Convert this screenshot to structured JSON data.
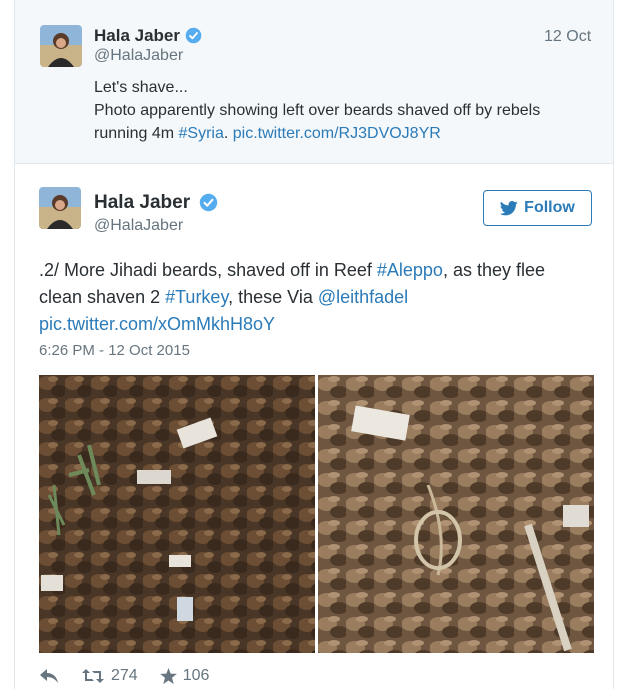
{
  "parent_tweet": {
    "name": "Hala Jaber",
    "handle": "@HalaJaber",
    "date": "12 Oct",
    "line1": "Let's shave...",
    "line2": "Photo apparently showing left over beards shaved off by rebels",
    "line3_text": "running 4m ",
    "line3_hashtag": "#Syria",
    "line3_sep": ". ",
    "line3_link": "pic.twitter.com/RJ3DVOJ8YR"
  },
  "main_tweet": {
    "name": "Hala Jaber",
    "handle": "@HalaJaber",
    "follow_label": "Follow",
    "text_part1": ".2/ More Jihadi beards, shaved off in Reef ",
    "hashtag_aleppo": "#Aleppo",
    "text_part2": ", as they flee",
    "text_part3": "clean shaven 2 ",
    "hashtag_turkey": "#Turkey",
    "text_part4": ", these Via ",
    "mention": "@leithfadel",
    "pic_link": "pic.twitter.com/xOmMkhH8oY",
    "timestamp": "6:26 PM - 12 Oct 2015",
    "retweets": "274",
    "favorites": "106"
  },
  "colors": {
    "link": "#2b7bb9",
    "verified": "#55acee",
    "muted": "#66757f",
    "parent_bg": "#f5f8fa"
  },
  "icons": [
    "verified-badge-icon",
    "twitter-bird-icon",
    "reply-icon",
    "retweet-icon",
    "favorite-star-icon"
  ]
}
